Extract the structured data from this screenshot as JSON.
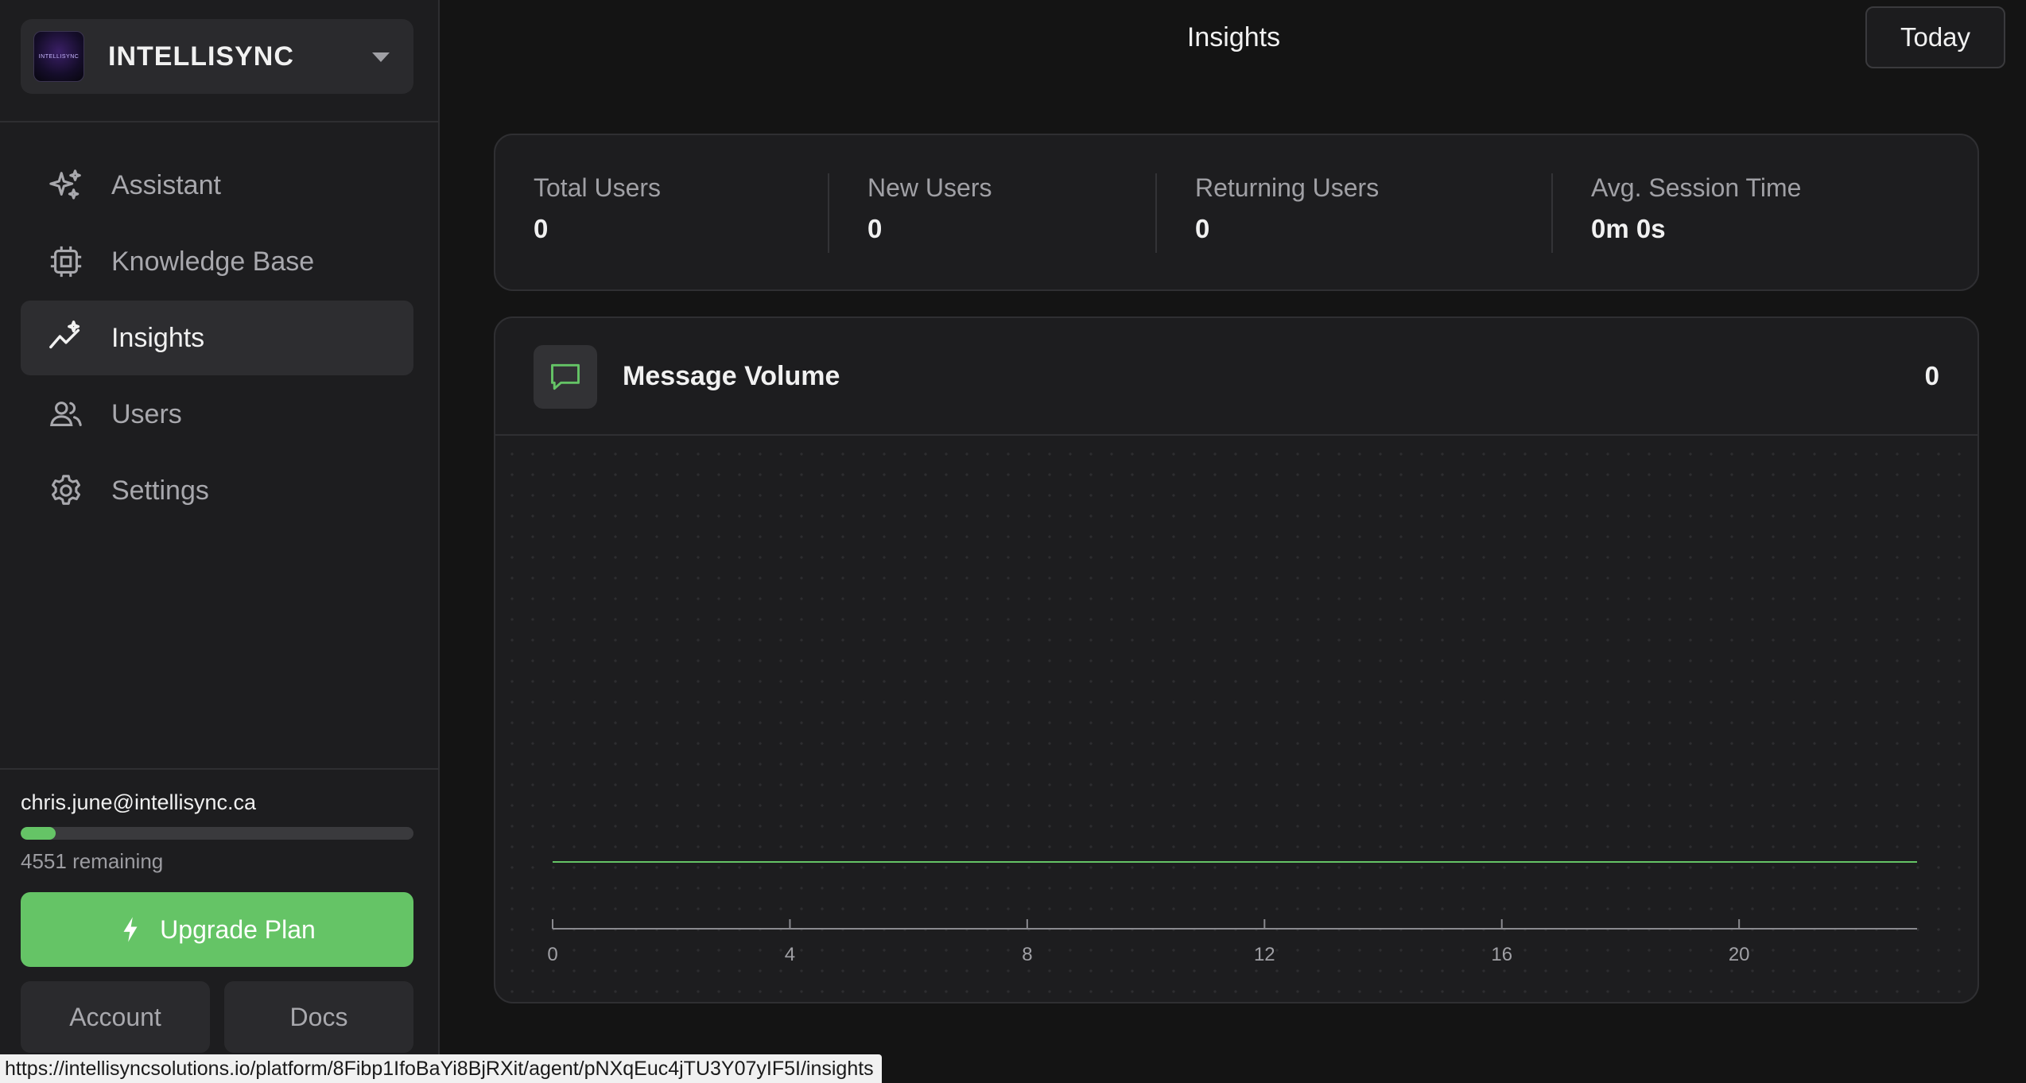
{
  "workspace": {
    "name": "INTELLISYNC",
    "logo_text": "INTELLISYNC"
  },
  "nav": {
    "items": [
      {
        "label": "Assistant",
        "icon": "sparkles-icon",
        "active": false
      },
      {
        "label": "Knowledge Base",
        "icon": "cpu-chip-icon",
        "active": false
      },
      {
        "label": "Insights",
        "icon": "trend-sparkle-icon",
        "active": true
      },
      {
        "label": "Users",
        "icon": "users-icon",
        "active": false
      },
      {
        "label": "Settings",
        "icon": "gear-icon",
        "active": false
      }
    ]
  },
  "account": {
    "email": "chris.june@intellisync.ca",
    "usage_fraction": 0.09,
    "remaining": "4551 remaining",
    "upgrade_label": "Upgrade Plan",
    "account_label": "Account",
    "docs_label": "Docs"
  },
  "header": {
    "title": "Insights",
    "range_label": "Today"
  },
  "stats": [
    {
      "label": "Total Users",
      "value": "0"
    },
    {
      "label": "New Users",
      "value": "0"
    },
    {
      "label": "Returning Users",
      "value": "0"
    },
    {
      "label": "Avg. Session Time",
      "value": "0m 0s"
    }
  ],
  "message_volume": {
    "title": "Message Volume",
    "total": "0"
  },
  "chart_data": {
    "type": "line",
    "x": [
      0,
      1,
      2,
      3,
      4,
      5,
      6,
      7,
      8,
      9,
      10,
      11,
      12,
      13,
      14,
      15,
      16,
      17,
      18,
      19,
      20,
      21,
      22,
      23
    ],
    "series": [
      {
        "values": [
          0,
          0,
          0,
          0,
          0,
          0,
          0,
          0,
          0,
          0,
          0,
          0,
          0,
          0,
          0,
          0,
          0,
          0,
          0,
          0,
          0,
          0,
          0,
          0
        ]
      }
    ],
    "x_ticks": [
      "0",
      "4",
      "8",
      "12",
      "16",
      "20"
    ],
    "x_tick_values": [
      0,
      4,
      8,
      12,
      16,
      20
    ],
    "xlim": [
      0,
      23
    ],
    "line_color": "#65c466",
    "grid": "dots"
  },
  "colors": {
    "accent": "#65c466",
    "background": "#141414",
    "panel": "#1d1d1f"
  },
  "status_bar": {
    "url": "https://intellisyncsolutions.io/platform/8Fibp1IfoBaYi8BjRXit/agent/pNXqEuc4jTU3Y07yIF5I/insights"
  }
}
